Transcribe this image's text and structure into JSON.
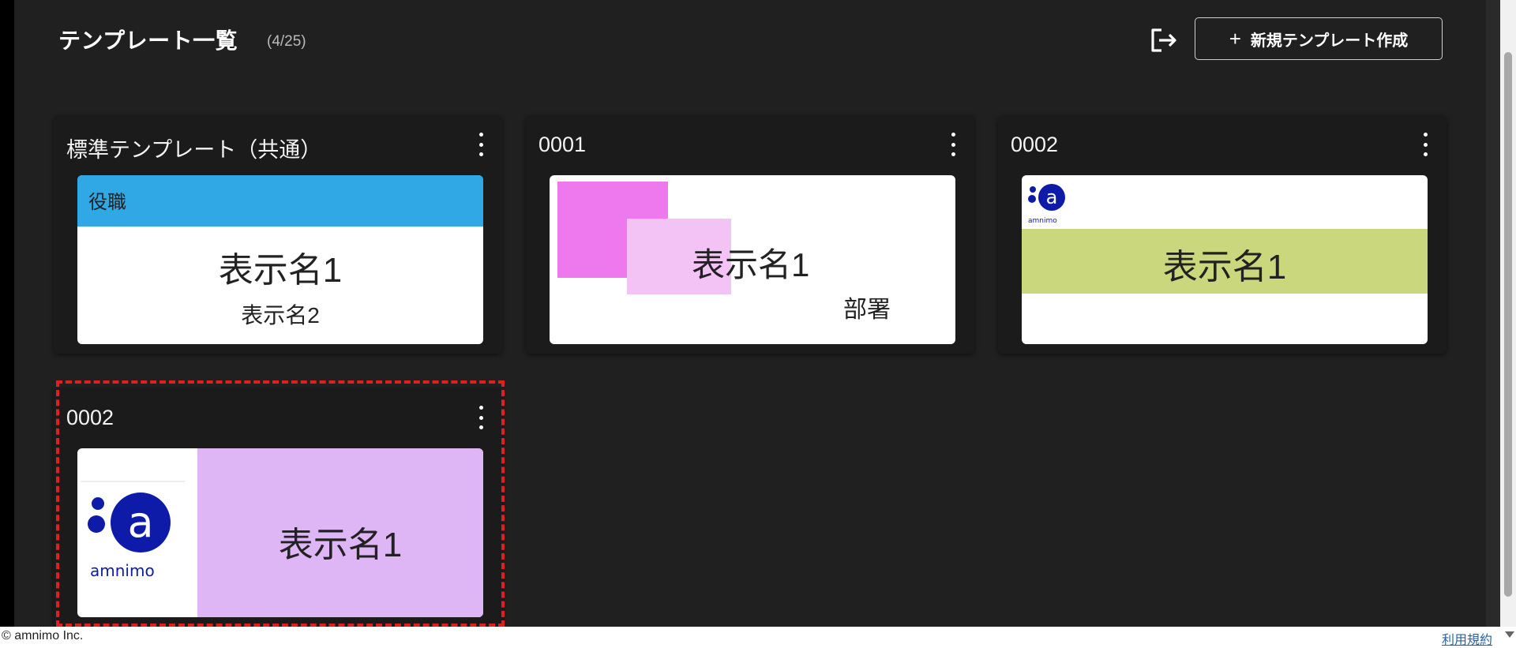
{
  "header": {
    "title": "テンプレート一覧",
    "count": "(4/25)",
    "create_button_label": "新規テンプレート作成",
    "create_button_icon": "plus-icon",
    "logout_icon": "logout-icon"
  },
  "templates": [
    {
      "title": "標準テンプレート（共通）",
      "role_label": "役職",
      "name_label": "表示名1",
      "sub_label": "表示名2",
      "accent": "#30a8e6"
    },
    {
      "title": "0001",
      "name_label": "表示名1",
      "dept_label": "部署",
      "accent": "#ee79ef",
      "accent_light": "#f3c3f6"
    },
    {
      "title": "0002",
      "name_label": "表示名1",
      "logo_text": "amnimo",
      "accent": "#cbd77d"
    },
    {
      "title": "0002",
      "name_label": "表示名1",
      "logo_text": "amnimo",
      "accent": "#deb5f5"
    }
  ],
  "footer": {
    "copyright": "© amnimo Inc.",
    "terms_link": "利用規約"
  },
  "colors": {
    "background": "#202020",
    "card": "#1b1b1b",
    "logo_blue": "#0d1ba8",
    "highlight": "#e02020"
  }
}
